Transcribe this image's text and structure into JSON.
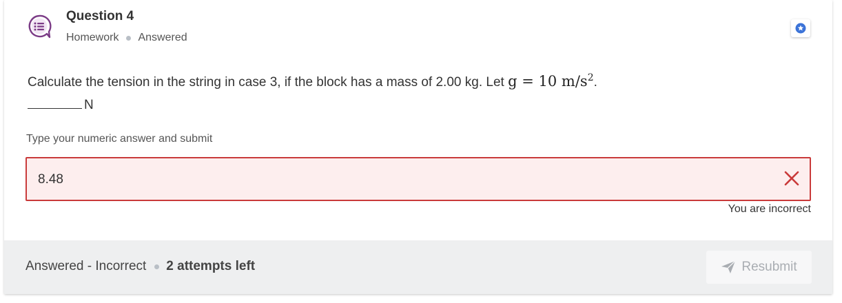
{
  "question": {
    "title": "Question 4",
    "type_label": "Homework",
    "state_label": "Answered",
    "text_prefix": "Calculate the tension in the string in case 3, if the block has a mass of 2.00 kg. Let ",
    "math_var": "g",
    "math_eq": "=",
    "math_value": "10",
    "math_unit": "m/s",
    "math_exp": "2",
    "text_suffix": ".",
    "unit": "N"
  },
  "answer": {
    "hint": "Type your numeric answer and submit",
    "value": "8.48",
    "feedback": "You are incorrect"
  },
  "footer": {
    "status": "Answered - Incorrect",
    "attempts": "2 attempts left",
    "resubmit_label": "Resubmit"
  },
  "colors": {
    "icon_purple": "#7b3b86",
    "star_blue": "#3b73d8",
    "error_red": "#c93a3a",
    "error_bg": "#fdeeee"
  },
  "icons": [
    "question-bubble-icon",
    "star-icon",
    "close-x-icon",
    "paper-plane-icon"
  ]
}
